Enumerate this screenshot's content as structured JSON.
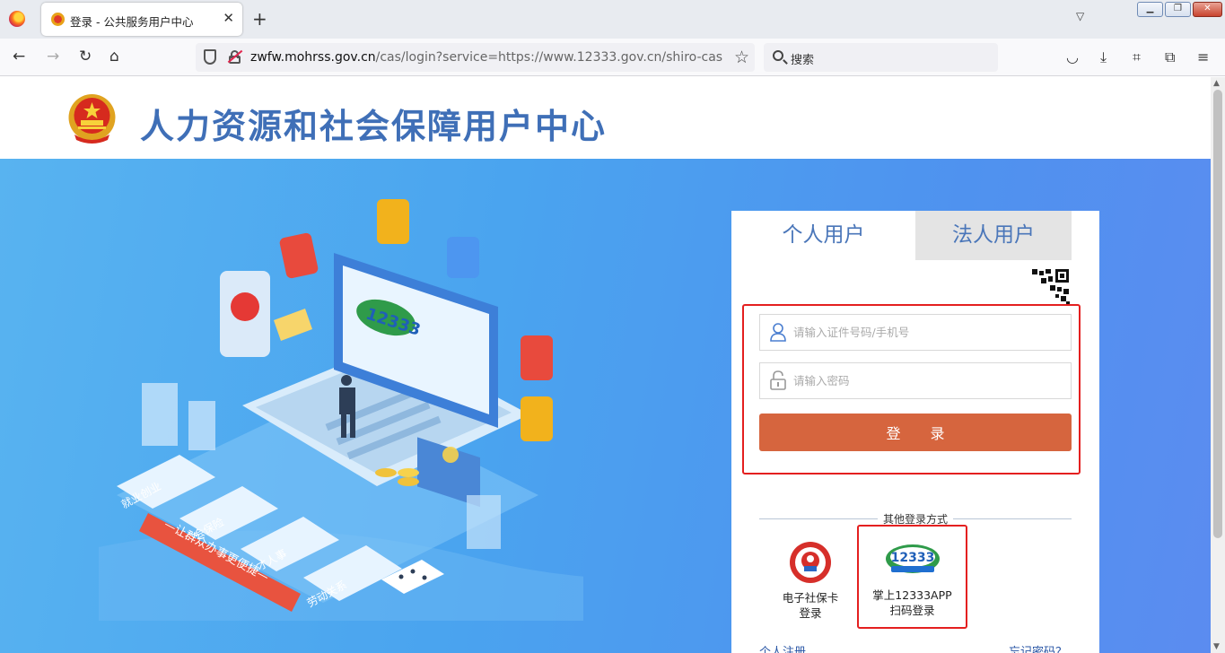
{
  "browser": {
    "tab_title": "登录 - 公共服务用户中心",
    "url_domain": "zwfw.mohrss.gov.cn",
    "url_path": "/cas/login?service=https://www.12333.gov.cn/shiro-cas",
    "search_placeholder": "搜索",
    "icons": [
      "firefox-logo",
      "back-arrow",
      "forward-arrow",
      "reload",
      "home",
      "shield",
      "broken-lock",
      "bookmark-star",
      "search",
      "pocket",
      "download",
      "crop",
      "extensions",
      "menu"
    ]
  },
  "header": {
    "site_title": "人力资源和社会保障用户中心"
  },
  "hero": {
    "slogan": "—让群众办事更便捷—",
    "tiles": [
      "就业创业",
      "社会保险",
      "人才人事",
      "劳动关系"
    ],
    "brand_number": "12333"
  },
  "login": {
    "tab_personal": "个人用户",
    "tab_corporate": "法人用户",
    "username_placeholder": "请输入证件号码/手机号",
    "password_placeholder": "请输入密码",
    "login_button": "登 录",
    "other_methods_title": "其他登录方式",
    "ecard_label_line1": "电子社保卡",
    "ecard_label_line2": "登录",
    "app_label_line1": "掌上12333APP",
    "app_label_line2": "扫码登录",
    "register_link": "个人注册",
    "forgot_link": "忘记密码？"
  },
  "colors": {
    "title_blue": "#3f6fb7",
    "hero_blue": "#4aa4ef",
    "login_button": "#d6653e",
    "highlight_red": "#e41f1f",
    "tab_inactive_bg": "#e4e4e4"
  }
}
